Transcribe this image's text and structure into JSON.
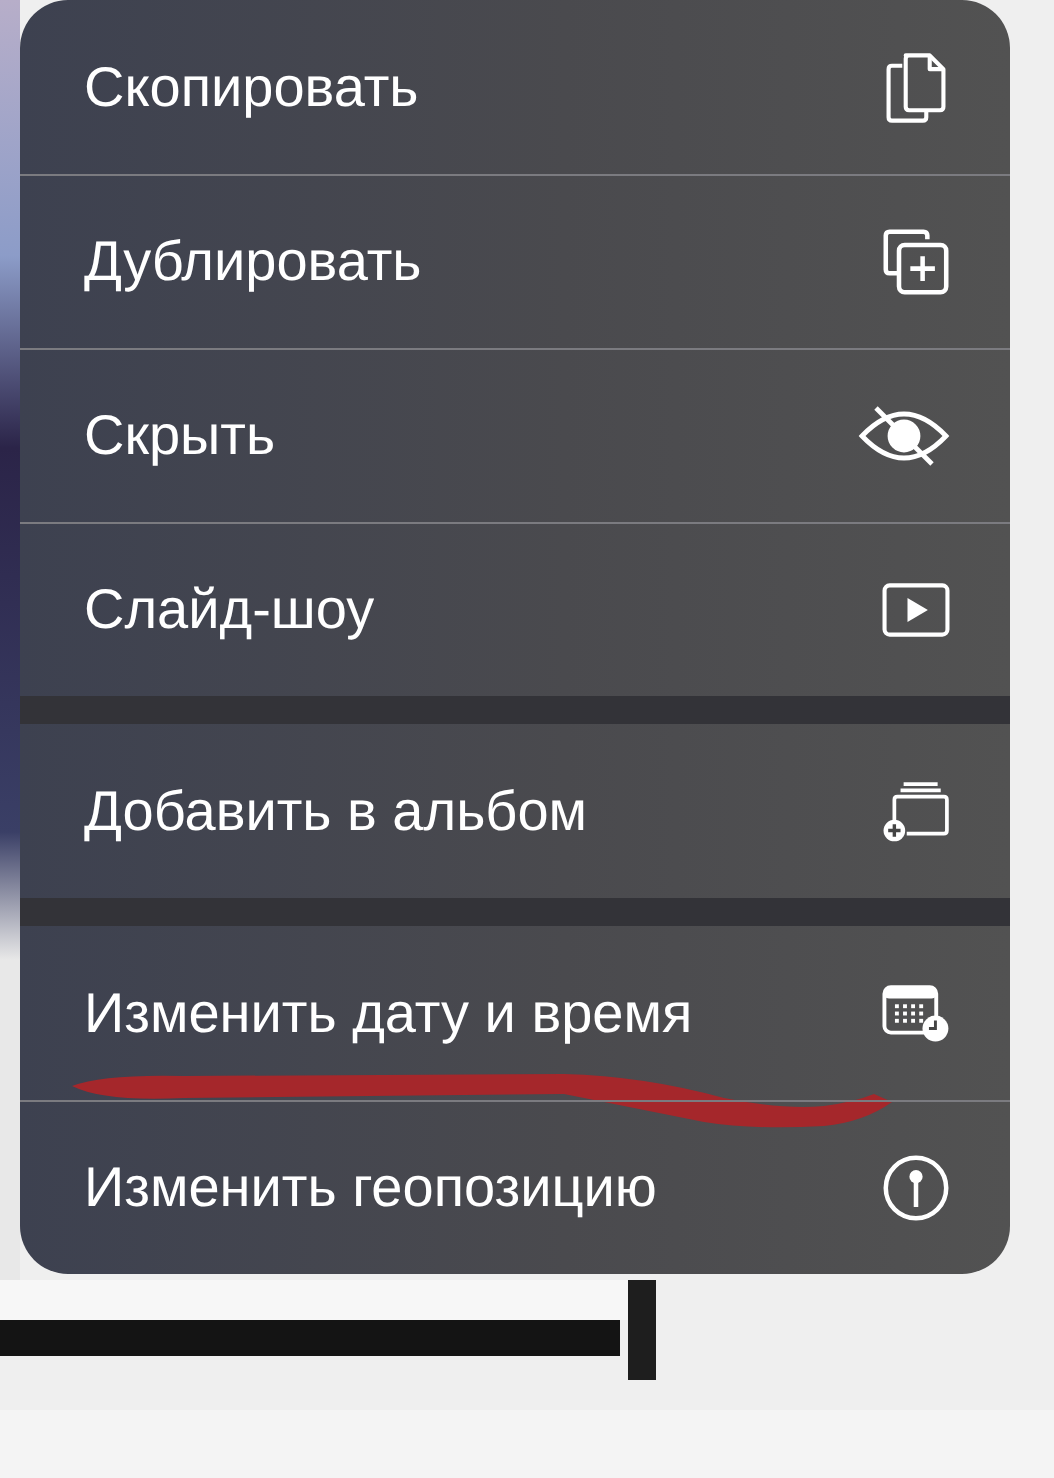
{
  "menu": {
    "groups": [
      {
        "items": [
          {
            "label": "Скопировать",
            "underlined": false
          },
          {
            "label": "Дублировать",
            "underlined": false
          },
          {
            "label": "Скрыть",
            "underlined": false
          },
          {
            "label": "Слайд-шоу",
            "underlined": false
          }
        ]
      },
      {
        "items": [
          {
            "label": "Добавить в альбом",
            "underlined": false
          }
        ]
      },
      {
        "items": [
          {
            "label": "Изменить дату и время",
            "underlined": true
          },
          {
            "label": "Изменить геопозицию",
            "underlined": false
          }
        ]
      }
    ]
  }
}
